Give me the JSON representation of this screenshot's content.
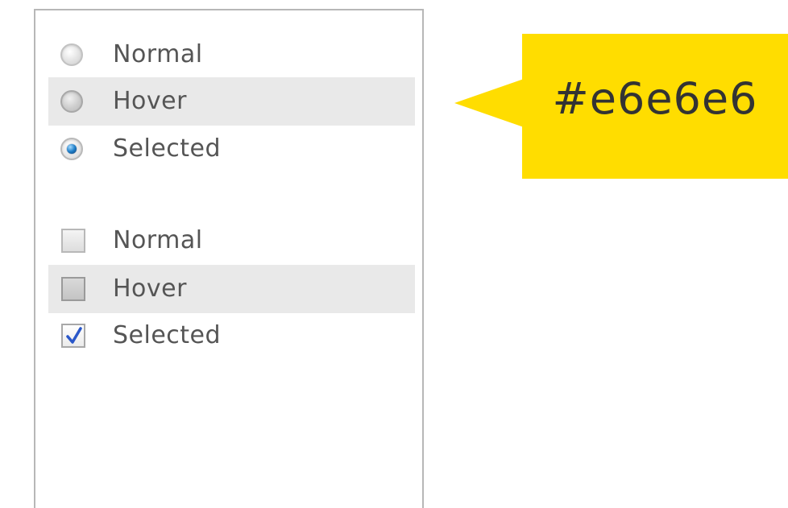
{
  "radio_group": {
    "items": [
      {
        "label": "Normal",
        "state": "normal"
      },
      {
        "label": "Hover",
        "state": "hover"
      },
      {
        "label": "Selected",
        "state": "selected"
      }
    ]
  },
  "checkbox_group": {
    "items": [
      {
        "label": "Normal",
        "state": "normal"
      },
      {
        "label": "Hover",
        "state": "hover"
      },
      {
        "label": "Selected",
        "state": "selected"
      }
    ]
  },
  "callout": {
    "text": "#e6e6e6",
    "color": "#ffdd00"
  },
  "colors": {
    "hover_background": "#e9e9e9",
    "selected_radio_dot": "#1f7fc9",
    "check_mark": "#2a57c9"
  }
}
